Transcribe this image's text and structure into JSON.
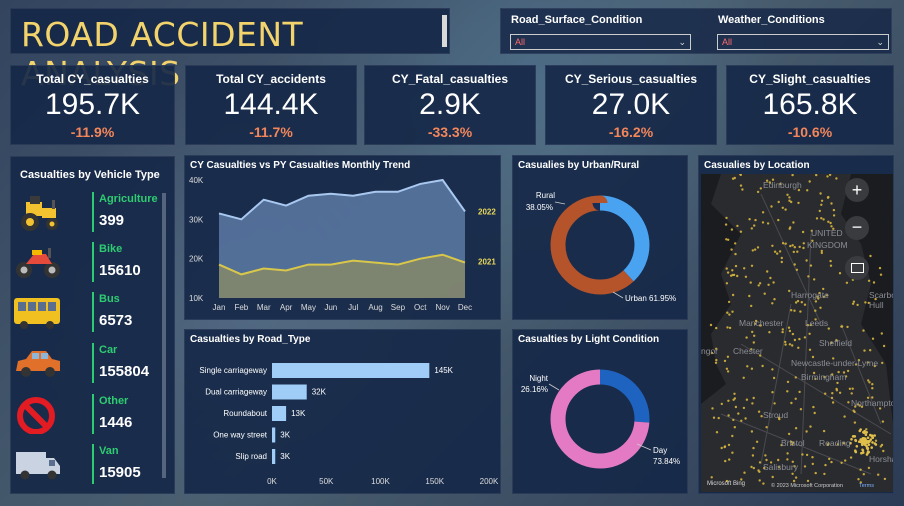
{
  "title": "ROAD ACCIDENT ANALYSIS",
  "filters": [
    {
      "label": "Road_Surface_Condition",
      "value": "All"
    },
    {
      "label": "Weather_Conditions",
      "value": "All"
    }
  ],
  "kpis": [
    {
      "label": "Total CY_casualties",
      "value": "195.7K",
      "change": "-11.9%"
    },
    {
      "label": "Total CY_accidents",
      "value": "144.4K",
      "change": "-11.7%"
    },
    {
      "label": "CY_Fatal_casualties",
      "value": "2.9K",
      "change": "-33.3%"
    },
    {
      "label": "CY_Serious_casualties",
      "value": "27.0K",
      "change": "-16.2%"
    },
    {
      "label": "CY_Slight_casualties",
      "value": "165.8K",
      "change": "-10.6%"
    }
  ],
  "vehicles": {
    "title": "Casualties by Vehicle Type",
    "items": [
      {
        "label": "Agriculture",
        "value": "399",
        "icon": "tractor-icon"
      },
      {
        "label": "Bike",
        "value": "15610",
        "icon": "motorbike-icon"
      },
      {
        "label": "Bus",
        "value": "6573",
        "icon": "bus-icon"
      },
      {
        "label": "Car",
        "value": "155804",
        "icon": "car-icon"
      },
      {
        "label": "Other",
        "value": "1446",
        "icon": "no-entry-icon"
      },
      {
        "label": "Van",
        "value": "15905",
        "icon": "van-icon"
      }
    ]
  },
  "trend": {
    "title": "CY Casualties vs PY Casualties Monthly Trend",
    "chart_data": {
      "type": "area",
      "x": [
        "Jan",
        "Feb",
        "Mar",
        "Apr",
        "May",
        "Jun",
        "Jul",
        "Aug",
        "Sep",
        "Oct",
        "Nov",
        "Dec"
      ],
      "series": [
        {
          "name": "2022",
          "values": [
            31.5,
            30,
            35,
            33.5,
            36,
            36.5,
            36,
            37,
            37,
            39,
            40,
            32
          ],
          "color": "#a9c8f0"
        },
        {
          "name": "2021",
          "values": [
            18.5,
            16,
            17.5,
            17,
            18.5,
            18.5,
            19.5,
            19,
            18.5,
            20,
            21,
            19
          ],
          "color": "#d9c74a"
        }
      ],
      "yticks": [
        "10K",
        "20K",
        "30K",
        "40K"
      ],
      "ylim": [
        10,
        40
      ]
    }
  },
  "urban": {
    "title": "Casualies by Urban/Rural",
    "chart_data": {
      "type": "pie",
      "slices": [
        {
          "name": "Rural",
          "pct": 38.05,
          "label": "38.05%",
          "color": "#4aa3f0"
        },
        {
          "name": "Urban",
          "pct": 61.95,
          "label": "61.95%",
          "color": "#b5532a"
        }
      ]
    }
  },
  "location": {
    "title": "Casualies by Location",
    "places": [
      "Edinburgh",
      "UNITED",
      "KINGDOM",
      "Harrogate",
      "Scarbor",
      "Hull",
      "Manchester",
      "Leeds",
      "Sheffield",
      "ngor",
      "Chester",
      "Newcastle-under-Lyme",
      "Birmingham",
      "Northampton",
      "Stroud",
      "Bristol",
      "Reading",
      "Salisbury",
      "Horsha"
    ],
    "credit": "© 2023 Microsoft Corporation",
    "terms": "Terms",
    "brand": "Microsoft Bing"
  },
  "road": {
    "title": "Casualties by Road_Type",
    "chart_data": {
      "type": "bar",
      "categories": [
        "Single carriageway",
        "Dual carriageway",
        "Roundabout",
        "One way street",
        "Slip road"
      ],
      "values": [
        145,
        32,
        13,
        3,
        3
      ],
      "labels": [
        "145K",
        "32K",
        "13K",
        "3K",
        "3K"
      ],
      "xticks": [
        "0K",
        "50K",
        "100K",
        "150K",
        "200K"
      ],
      "xlim": [
        0,
        200
      ]
    }
  },
  "light": {
    "title": "Casualties by Light Condition",
    "chart_data": {
      "type": "pie",
      "slices": [
        {
          "name": "Night",
          "pct": 26.16,
          "label": "26.16%",
          "color": "#1f63c0"
        },
        {
          "name": "Day",
          "pct": 73.84,
          "label": "73.84%",
          "color": "#e57ac4"
        }
      ]
    }
  }
}
